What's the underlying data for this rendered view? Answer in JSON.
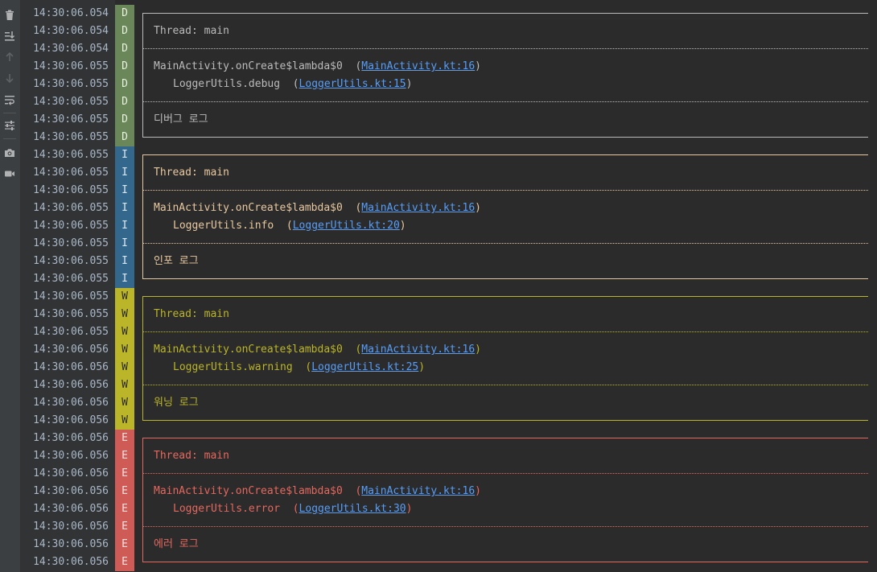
{
  "toolbar": {
    "buttons": [
      {
        "icon": "trash-icon",
        "name": "clear-logcat-button"
      },
      {
        "icon": "scroll-to-end-icon",
        "name": "scroll-to-end-button"
      },
      {
        "icon": "arrow-up-icon",
        "name": "previous-occurrence-button"
      },
      {
        "icon": "arrow-down-icon",
        "name": "next-occurrence-button"
      },
      {
        "icon": "soft-wrap-icon",
        "name": "soft-wrap-button"
      },
      {
        "icon": "settings-sliders-icon",
        "name": "logcat-settings-button"
      },
      {
        "icon": "camera-icon",
        "name": "screen-capture-button"
      },
      {
        "icon": "video-camera-icon",
        "name": "screen-record-button"
      }
    ]
  },
  "colors": {
    "debug": "#6a8759",
    "info": "#34678c",
    "warning": "#bbb529",
    "error": "#cf5b56",
    "link": "#589df6"
  },
  "rows": [
    {
      "time": "14:30:06.054",
      "level": "D",
      "kind": "top",
      "text": ""
    },
    {
      "time": "14:30:06.054",
      "level": "D",
      "kind": "text",
      "text": "Thread: main"
    },
    {
      "time": "14:30:06.054",
      "level": "D",
      "kind": "dots",
      "text": ""
    },
    {
      "time": "14:30:06.055",
      "level": "D",
      "kind": "trace",
      "text": "MainActivity.onCreate$lambda$0  (",
      "link": "MainActivity.kt:16",
      "suffix": ")"
    },
    {
      "time": "14:30:06.055",
      "level": "D",
      "kind": "trace2",
      "text": "LoggerUtils.debug  (",
      "link": "LoggerUtils.kt:15",
      "suffix": ")"
    },
    {
      "time": "14:30:06.055",
      "level": "D",
      "kind": "dots",
      "text": ""
    },
    {
      "time": "14:30:06.055",
      "level": "D",
      "kind": "text",
      "text": "디버그 로그"
    },
    {
      "time": "14:30:06.055",
      "level": "D",
      "kind": "bottom",
      "text": ""
    },
    {
      "time": "14:30:06.055",
      "level": "I",
      "kind": "top",
      "text": ""
    },
    {
      "time": "14:30:06.055",
      "level": "I",
      "kind": "text",
      "text": "Thread: main"
    },
    {
      "time": "14:30:06.055",
      "level": "I",
      "kind": "dots",
      "text": ""
    },
    {
      "time": "14:30:06.055",
      "level": "I",
      "kind": "trace",
      "text": "MainActivity.onCreate$lambda$0  (",
      "link": "MainActivity.kt:16",
      "suffix": ")"
    },
    {
      "time": "14:30:06.055",
      "level": "I",
      "kind": "trace2",
      "text": "LoggerUtils.info  (",
      "link": "LoggerUtils.kt:20",
      "suffix": ")"
    },
    {
      "time": "14:30:06.055",
      "level": "I",
      "kind": "dots",
      "text": ""
    },
    {
      "time": "14:30:06.055",
      "level": "I",
      "kind": "text",
      "text": "인포 로그"
    },
    {
      "time": "14:30:06.055",
      "level": "I",
      "kind": "bottom",
      "text": ""
    },
    {
      "time": "14:30:06.055",
      "level": "W",
      "kind": "top",
      "text": ""
    },
    {
      "time": "14:30:06.055",
      "level": "W",
      "kind": "text",
      "text": "Thread: main"
    },
    {
      "time": "14:30:06.055",
      "level": "W",
      "kind": "dots",
      "text": ""
    },
    {
      "time": "14:30:06.056",
      "level": "W",
      "kind": "trace",
      "text": "MainActivity.onCreate$lambda$0  (",
      "link": "MainActivity.kt:16",
      "suffix": ")"
    },
    {
      "time": "14:30:06.056",
      "level": "W",
      "kind": "trace2",
      "text": "LoggerUtils.warning  (",
      "link": "LoggerUtils.kt:25",
      "suffix": ")"
    },
    {
      "time": "14:30:06.056",
      "level": "W",
      "kind": "dots",
      "text": ""
    },
    {
      "time": "14:30:06.056",
      "level": "W",
      "kind": "text",
      "text": "워닝 로그"
    },
    {
      "time": "14:30:06.056",
      "level": "W",
      "kind": "bottom",
      "text": ""
    },
    {
      "time": "14:30:06.056",
      "level": "E",
      "kind": "top",
      "text": ""
    },
    {
      "time": "14:30:06.056",
      "level": "E",
      "kind": "text",
      "text": "Thread: main"
    },
    {
      "time": "14:30:06.056",
      "level": "E",
      "kind": "dots",
      "text": ""
    },
    {
      "time": "14:30:06.056",
      "level": "E",
      "kind": "trace",
      "text": "MainActivity.onCreate$lambda$0  (",
      "link": "MainActivity.kt:16",
      "suffix": ")"
    },
    {
      "time": "14:30:06.056",
      "level": "E",
      "kind": "trace2",
      "text": "LoggerUtils.error  (",
      "link": "LoggerUtils.kt:30",
      "suffix": ")"
    },
    {
      "time": "14:30:06.056",
      "level": "E",
      "kind": "dots",
      "text": ""
    },
    {
      "time": "14:30:06.056",
      "level": "E",
      "kind": "text",
      "text": "에러 로그"
    },
    {
      "time": "14:30:06.056",
      "level": "E",
      "kind": "bottom",
      "text": ""
    }
  ]
}
